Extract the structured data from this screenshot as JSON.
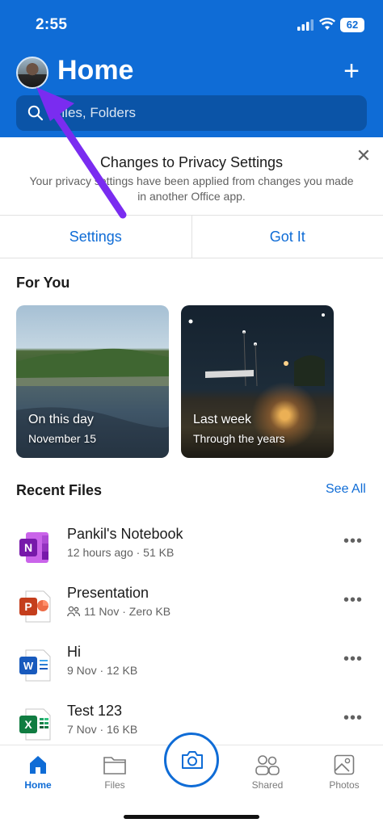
{
  "status_bar": {
    "time": "2:55",
    "battery": "62"
  },
  "header": {
    "title": "Home",
    "search_placeholder": "Files, Folders"
  },
  "banner": {
    "title": "Changes to Privacy Settings",
    "body": "Your privacy settings have been applied from changes you made in another Office app.",
    "settings_label": "Settings",
    "got_it_label": "Got It"
  },
  "for_you": {
    "title": "For You",
    "cards": [
      {
        "title": "On this day",
        "subtitle": "November 15"
      },
      {
        "title": "Last week",
        "subtitle": "Through the years"
      }
    ]
  },
  "recent": {
    "title": "Recent Files",
    "see_all": "See All",
    "files": [
      {
        "name": "Pankil's Notebook",
        "meta": "12 hours ago · 51 KB",
        "icon": "onenote-icon",
        "color": "#7719aa"
      },
      {
        "name": "Presentation",
        "meta": "11 Nov · Zero KB",
        "icon": "powerpoint-icon",
        "color": "#c43e1c",
        "shared": true
      },
      {
        "name": "Hi",
        "meta": "9 Nov · 12 KB",
        "icon": "word-icon",
        "color": "#185abd"
      },
      {
        "name": "Test 123",
        "meta": "7 Nov · 16 KB",
        "icon": "excel-icon",
        "color": "#107c41"
      }
    ]
  },
  "nav": {
    "home": "Home",
    "files": "Files",
    "shared": "Shared",
    "photos": "Photos"
  },
  "colors": {
    "accent": "#0f6cd6",
    "annotation": "#7a2cf0"
  }
}
